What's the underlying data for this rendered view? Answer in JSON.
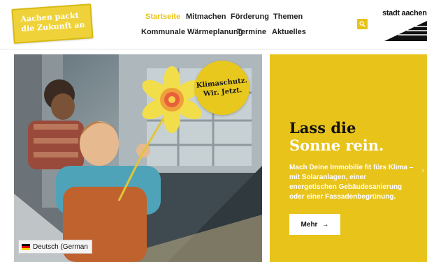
{
  "header": {
    "logo_line1": "Aachen packt",
    "logo_line2": "die Zukunft an",
    "nav_row1": [
      {
        "label": "Startseite",
        "active": true
      },
      {
        "label": "Mitmachen",
        "active": false
      },
      {
        "label": "Förderung",
        "active": false
      },
      {
        "label": "Themen",
        "active": false
      }
    ],
    "nav_row2": [
      {
        "label": "Kommunale Wärmeplanung"
      },
      {
        "label": "Termine"
      },
      {
        "label": "Aktuelles"
      }
    ],
    "city_logo_text": "stadt aachen"
  },
  "hero": {
    "sticker_line1": "Klimaschutz.",
    "sticker_line2": "Wir. Jetzt.",
    "language_label": "Deutsch (German"
  },
  "panel": {
    "headline1": "Lass die",
    "headline2": "Sonne rein.",
    "body": "Mach Deine Immobilie fit fürs Klima – mit Solaranlagen, einer energetischen Gebäudesanierung oder einer Fassadenbegrünung.",
    "more_label": "Mehr",
    "more_arrow": "→",
    "next_glyph": "›"
  },
  "colors": {
    "accent_yellow": "#e8c31a",
    "logo_yellow": "#efd23a",
    "text_dark": "#222222"
  },
  "icons": [
    "search-icon",
    "arrow-right-icon",
    "chevron-right-icon",
    "german-flag-icon"
  ]
}
